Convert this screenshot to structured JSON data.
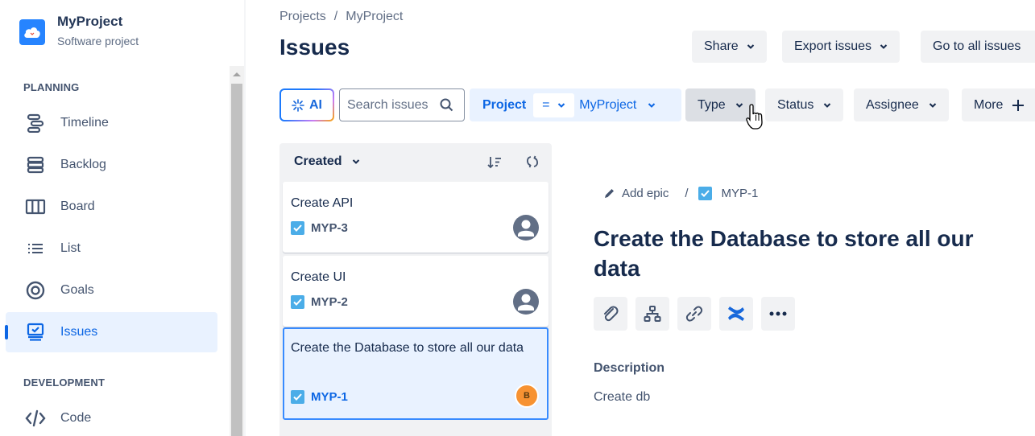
{
  "project": {
    "name": "MyProject",
    "type": "Software project",
    "logo_icon": "cloud-icon"
  },
  "sidebar": {
    "sections": [
      {
        "label": "PLANNING"
      },
      {
        "label": "DEVELOPMENT"
      }
    ],
    "items": [
      {
        "label": "Timeline",
        "icon": "timeline-icon"
      },
      {
        "label": "Backlog",
        "icon": "backlog-icon"
      },
      {
        "label": "Board",
        "icon": "board-icon"
      },
      {
        "label": "List",
        "icon": "list-icon"
      },
      {
        "label": "Goals",
        "icon": "goals-icon"
      },
      {
        "label": "Issues",
        "icon": "issues-icon",
        "active": true
      },
      {
        "label": "Code",
        "icon": "code-icon"
      }
    ]
  },
  "header": {
    "breadcrumb": [
      "Projects",
      "/",
      "MyProject"
    ],
    "title": "Issues",
    "buttons": {
      "share": "Share",
      "export": "Export issues",
      "all_issues": "Go to all issues"
    }
  },
  "filters": {
    "ai_label": "AI",
    "search_placeholder": "Search issues",
    "project": {
      "label": "Project",
      "operator": "=",
      "value": "MyProject"
    },
    "type": "Type",
    "status": "Status",
    "assignee": "Assignee",
    "more": "More"
  },
  "list": {
    "sort_label": "Created",
    "issues": [
      {
        "title": "Create API",
        "key": "MYP-3",
        "assignee": "unassigned"
      },
      {
        "title": "Create UI",
        "key": "MYP-2",
        "assignee": "unassigned"
      },
      {
        "title": "Create the Database to store all our data",
        "key": "MYP-1",
        "assignee": "B",
        "selected": true
      }
    ]
  },
  "detail": {
    "add_epic": "Add epic",
    "separator": "/",
    "key": "MYP-1",
    "title": "Create the Database to store all our data",
    "actions": [
      "attach-icon",
      "child-issues-icon",
      "link-icon",
      "confluence-icon",
      "more-icon"
    ],
    "description_label": "Description",
    "description": "Create db"
  },
  "colors": {
    "accent": "#0c66e4",
    "selected_bg": "#e9f2ff",
    "avatar_b": "#f79232",
    "task_icon": "#4bade8"
  }
}
